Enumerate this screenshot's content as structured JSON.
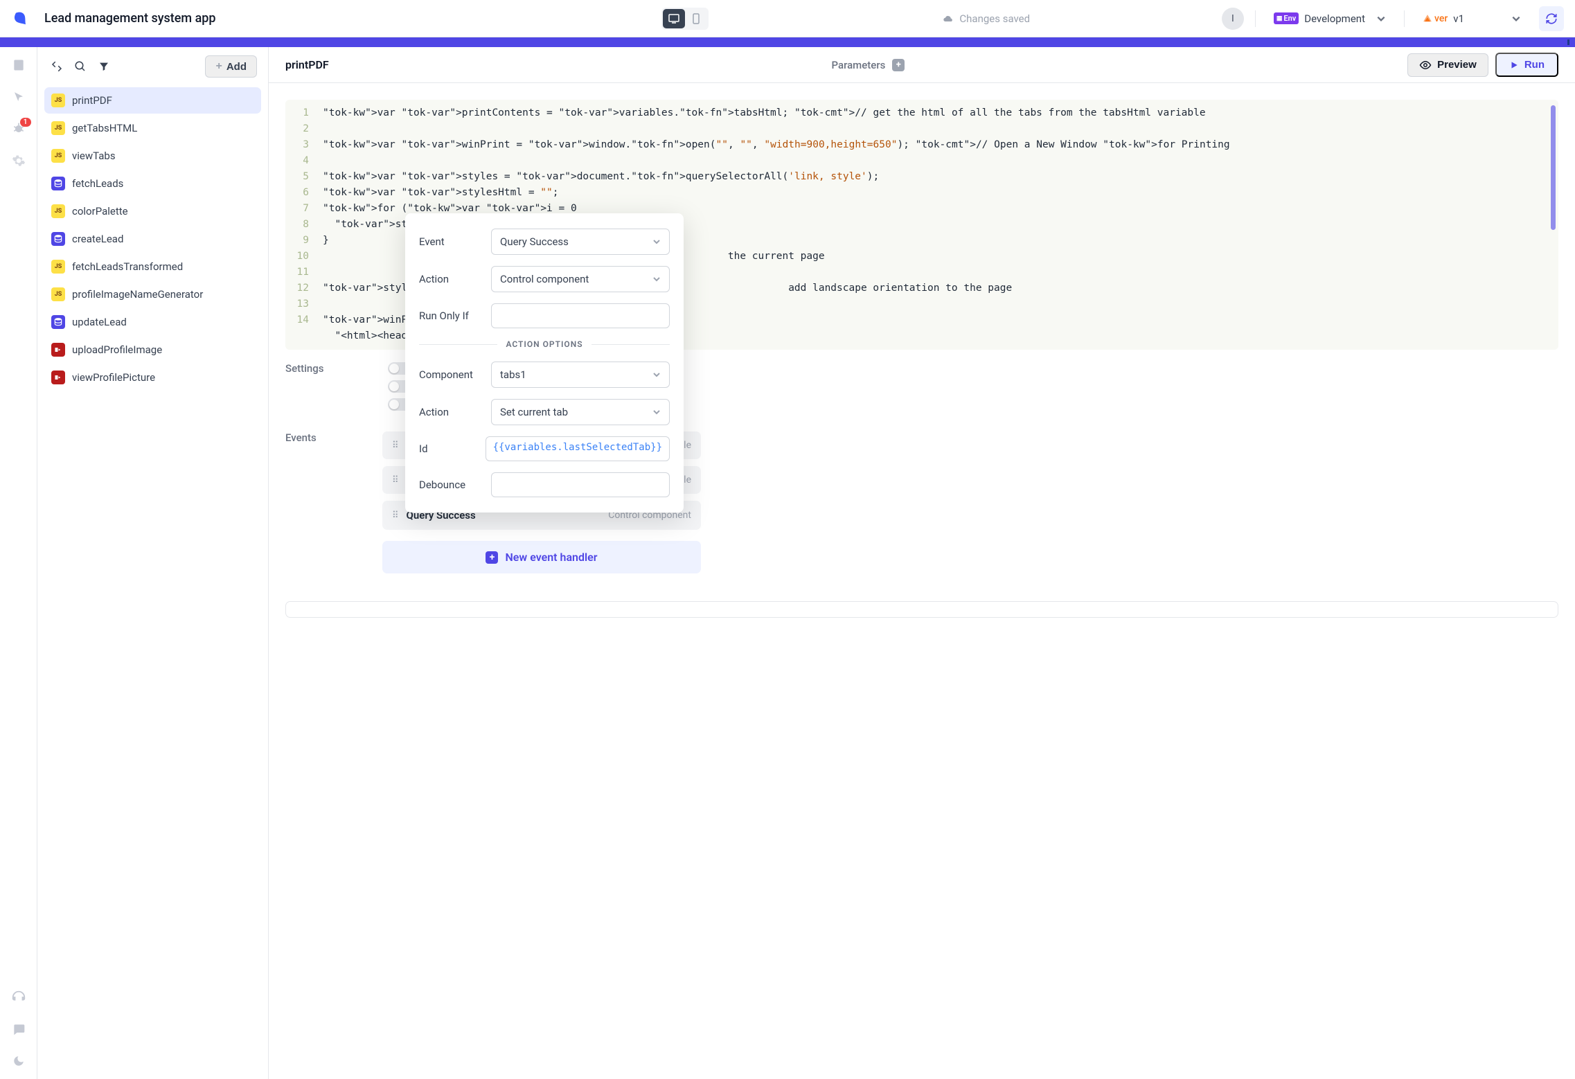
{
  "header": {
    "app_title": "Lead management system app",
    "save_status": "Changes saved",
    "avatar_initial": "I",
    "env_label": "Env",
    "env_value": "Development",
    "ver_label": "ver",
    "ver_value": "v1"
  },
  "rail": {
    "debug_badge": "1"
  },
  "sidebar": {
    "add_label": "Add",
    "items": [
      {
        "icon": "js",
        "label": "printPDF",
        "active": true
      },
      {
        "icon": "js",
        "label": "getTabsHTML"
      },
      {
        "icon": "js",
        "label": "viewTabs"
      },
      {
        "icon": "db",
        "label": "fetchLeads"
      },
      {
        "icon": "js",
        "label": "colorPalette"
      },
      {
        "icon": "db",
        "label": "createLead"
      },
      {
        "icon": "js",
        "label": "fetchLeadsTransformed"
      },
      {
        "icon": "js",
        "label": "profileImageNameGenerator"
      },
      {
        "icon": "db",
        "label": "updateLead"
      },
      {
        "icon": "api",
        "label": "uploadProfileImage"
      },
      {
        "icon": "api",
        "label": "viewProfilePicture"
      }
    ]
  },
  "main": {
    "title": "printPDF",
    "params_label": "Parameters",
    "preview_label": "Preview",
    "run_label": "Run",
    "settings_label": "Settings",
    "events_label": "Events",
    "new_handler_label": "New event handler",
    "event_rows": [
      {
        "name_tail": "le"
      },
      {
        "name_tail": "le"
      },
      {
        "name": "Query Success",
        "action": "Control component"
      }
    ]
  },
  "code": {
    "lines": [
      "var printContents = variables.tabsHtml; // get the html of all the tabs from the tabsHtml variable",
      "",
      "var winPrint = window.open(\"\", \"\", \"width=900,height=650\"); // Open a New Window for Printing",
      "",
      "var styles = document.querySelectorAll('link, style');",
      "var stylesHtml = \"\";",
      "for (var i = 0",
      "  stylesHtml +",
      "}",
      "                                                                   the current page",
      "",
      "stylesHtml +=                                                      add landscape orientation to the page",
      "",
      "winPrint.docum",
      "  \"<html><head"
    ],
    "line_numbers": [
      "1",
      "2",
      "3",
      "4",
      "5",
      "6",
      "7",
      "8",
      "9",
      "10",
      "11",
      "12",
      "13",
      "14"
    ]
  },
  "popup": {
    "event_label": "Event",
    "event_value": "Query Success",
    "action_label": "Action",
    "action_value": "Control component",
    "run_only_if_label": "Run Only If",
    "divider_text": "ACTION OPTIONS",
    "component_label": "Component",
    "component_value": "tabs1",
    "action2_label": "Action",
    "action2_value": "Set current tab",
    "id_label": "Id",
    "id_value": "{{variables.lastSelectedTab}}",
    "debounce_label": "Debounce"
  }
}
